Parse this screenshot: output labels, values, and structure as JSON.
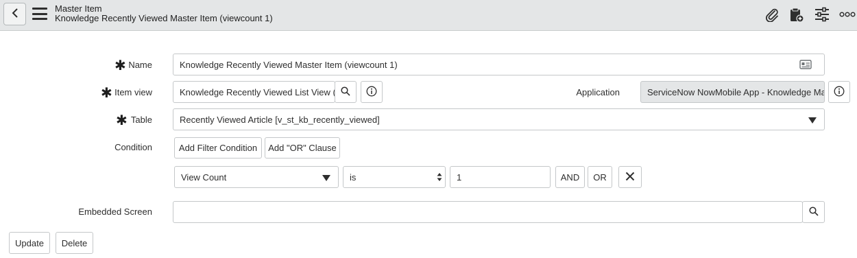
{
  "header": {
    "title": "Master Item",
    "subtitle": "Knowledge Recently Viewed Master Item (viewcount 1)",
    "icons": [
      "back-icon",
      "menu-icon",
      "paperclip-icon",
      "clipboard-add-icon",
      "sliders-icon",
      "more-icon"
    ]
  },
  "form": {
    "name": {
      "label": "Name",
      "value": "Knowledge Recently Viewed Master Item (viewcount 1)"
    },
    "item_view": {
      "label": "Item view",
      "value": "Knowledge Recently Viewed List View (v"
    },
    "application": {
      "label": "Application",
      "value": "ServiceNow NowMobile App - Knowledge Man"
    },
    "table": {
      "label": "Table",
      "value": "Recently Viewed Article [v_st_kb_recently_viewed]"
    },
    "condition": {
      "label": "Condition",
      "add_filter_label": "Add Filter Condition",
      "add_or_label": "Add \"OR\" Clause",
      "field": "View Count",
      "operator": "is",
      "value": "1",
      "and_label": "AND",
      "or_label": "OR"
    },
    "embedded_screen": {
      "label": "Embedded Screen",
      "value": ""
    }
  },
  "actions": {
    "update_label": "Update",
    "delete_label": "Delete"
  }
}
